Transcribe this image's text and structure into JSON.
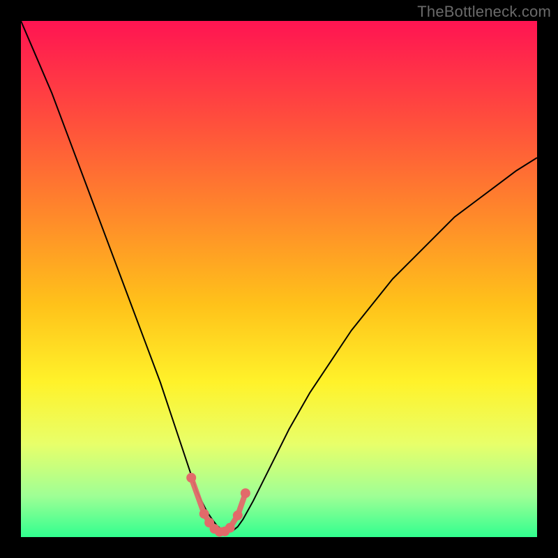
{
  "watermark": "TheBottleneck.com",
  "chart_data": {
    "type": "line",
    "title": "",
    "xlabel": "",
    "ylabel": "",
    "xlim": [
      0,
      100
    ],
    "ylim": [
      0,
      100
    ],
    "series": [
      {
        "name": "curve",
        "x": [
          0,
          3,
          6,
          9,
          12,
          15,
          18,
          21,
          24,
          27,
          29,
          31,
          33,
          34,
          35,
          36,
          37,
          38,
          39,
          40,
          41,
          42,
          43,
          45,
          48,
          52,
          56,
          60,
          64,
          68,
          72,
          76,
          80,
          84,
          88,
          92,
          96,
          100
        ],
        "y": [
          100,
          93,
          86,
          78,
          70,
          62,
          54,
          46,
          38,
          30,
          24,
          18,
          12,
          9,
          7,
          5,
          3.5,
          2.2,
          1.4,
          1,
          1.2,
          2,
          3.4,
          7,
          13,
          21,
          28,
          34,
          40,
          45,
          50,
          54,
          58,
          62,
          65,
          68,
          71,
          73.5
        ]
      }
    ],
    "markers": {
      "name": "trough-markers",
      "color": "#e26a6a",
      "x": [
        33,
        35.5,
        36.5,
        37.5,
        38.5,
        39.5,
        40.5,
        42,
        43.5
      ],
      "y": [
        11.5,
        4.5,
        2.8,
        1.6,
        1,
        1.1,
        1.8,
        4.2,
        8.5
      ]
    },
    "background_gradient": {
      "stops": [
        {
          "offset": 0.0,
          "color": "#ff1452"
        },
        {
          "offset": 0.18,
          "color": "#ff4a3e"
        },
        {
          "offset": 0.38,
          "color": "#ff8a2a"
        },
        {
          "offset": 0.55,
          "color": "#ffc21a"
        },
        {
          "offset": 0.7,
          "color": "#fff22a"
        },
        {
          "offset": 0.82,
          "color": "#e8ff6a"
        },
        {
          "offset": 0.92,
          "color": "#9fff95"
        },
        {
          "offset": 1.0,
          "color": "#31ff8f"
        }
      ]
    }
  }
}
